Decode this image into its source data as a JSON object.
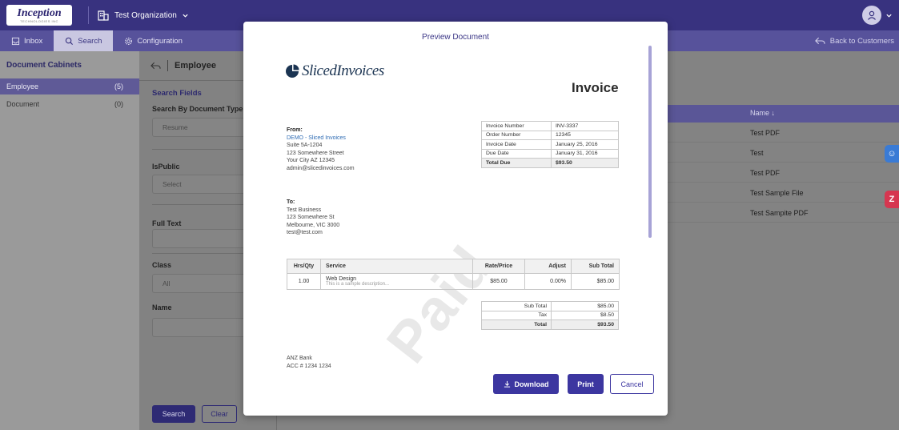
{
  "topbar": {
    "logo_text": "Inception",
    "logo_sub": "TECHNOLOGIES INC",
    "org_name": "Test Organization",
    "user_icon": "user-icon"
  },
  "nav": {
    "tabs": [
      {
        "label": "Inbox",
        "icon": "inbox-icon"
      },
      {
        "label": "Search",
        "icon": "search-icon"
      },
      {
        "label": "Configuration",
        "icon": "gear-icon"
      }
    ],
    "back_label": "Back to Customers"
  },
  "sidebar": {
    "title": "Document Cabinets",
    "items": [
      {
        "label": "Employee",
        "count": "(5)"
      },
      {
        "label": "Document",
        "count": "(0)"
      }
    ]
  },
  "panel": {
    "header": "Employee",
    "search_fields_title": "Search Fields",
    "search_by_label": "Search By Document Type",
    "search_by_value": "Resume",
    "ispublic_label": "IsPublic",
    "ispublic_value": "Select",
    "fulltext_label": "Full Text",
    "fulltext_value": "",
    "class_label": "Class",
    "class_value": "All",
    "name_label": "Name",
    "name_value": "",
    "search_button": "Search",
    "clear_button": "Clear"
  },
  "table": {
    "name_header": "Name ↓",
    "rows": [
      "Test PDF",
      "Test",
      "Test PDF",
      "Test Sample File",
      "Test Sampite PDF"
    ]
  },
  "modal": {
    "title": "Preview Document",
    "download_label": "Download",
    "print_label": "Print",
    "cancel_label": "Cancel"
  },
  "invoice": {
    "brand": "SlicedInvoices",
    "heading": "Invoice",
    "watermark": "Paid",
    "from": {
      "heading": "From:",
      "company": "DEMO - Sliced Invoices",
      "line1": "Suite 5A-1204",
      "line2": "123 Somewhere Street",
      "line3": "Your City AZ 12345",
      "email": "admin@slicedinvoices.com"
    },
    "to": {
      "heading": "To:",
      "line1": "Test Business",
      "line2": "123 Somewhere St",
      "line3": "Melbourne, VIC 3000",
      "email": "test@test.com"
    },
    "meta": [
      {
        "label": "Invoice Number",
        "value": "INV-3337"
      },
      {
        "label": "Order Number",
        "value": "12345"
      },
      {
        "label": "Invoice Date",
        "value": "January 25, 2016"
      },
      {
        "label": "Due Date",
        "value": "January 31, 2016"
      },
      {
        "label": "Total Due",
        "value": "$93.50"
      }
    ],
    "items_header": {
      "qty": "Hrs/Qty",
      "service": "Service",
      "rate": "Rate/Price",
      "adjust": "Adjust",
      "subtotal": "Sub Total"
    },
    "item": {
      "qty": "1.00",
      "service": "Web Design",
      "desc": "This is a sample description...",
      "rate": "$85.00",
      "adjust": "0.00%",
      "subtotal": "$85.00"
    },
    "totals": [
      {
        "label": "Sub Total",
        "value": "$85.00"
      },
      {
        "label": "Tax",
        "value": "$8.50"
      },
      {
        "label": "Total",
        "value": "$93.50"
      }
    ],
    "bank": {
      "line1": "ANZ Bank",
      "line2": "ACC # 1234 1234"
    }
  }
}
